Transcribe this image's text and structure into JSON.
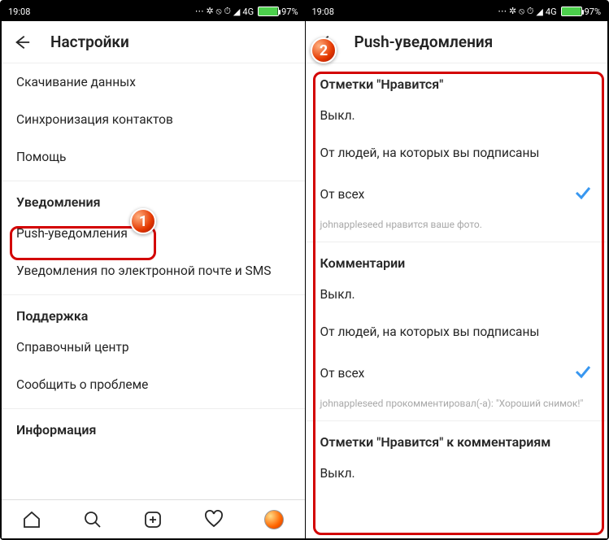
{
  "statusbar": {
    "time": "19:08",
    "network": "4G",
    "battery": "97%"
  },
  "left": {
    "header": {
      "title": "Настройки"
    },
    "items": {
      "download": "Скачивание данных",
      "sync": "Синхронизация контактов",
      "help": "Помощь"
    },
    "sections": {
      "notifications": "Уведомления",
      "support": "Поддержка",
      "info": "Информация"
    },
    "notif_items": {
      "push": "Push-уведомления",
      "email_sms": "Уведомления по электронной почте и SMS"
    },
    "support_items": {
      "help_center": "Справочный центр",
      "report": "Сообщить о проблеме"
    }
  },
  "right": {
    "header": {
      "title": "Push-уведомления"
    },
    "groups": {
      "likes": {
        "title": "Отметки \"Нравится\"",
        "opt_off": "Выкл.",
        "opt_following": "От людей, на которых вы подписаны",
        "opt_all": "От всех",
        "hint": "johnappleseed нравится ваше фото."
      },
      "comments": {
        "title": "Комментарии",
        "opt_off": "Выкл.",
        "opt_following": "От людей, на которых вы подписаны",
        "opt_all": "От всех",
        "hint": "johnappleseed прокомментировал(-а): \"Хороший снимок!\""
      },
      "comment_likes": {
        "title": "Отметки \"Нравится\" к комментариям",
        "opt_off": "Выкл."
      }
    }
  },
  "callouts": {
    "one": "1",
    "two": "2"
  }
}
